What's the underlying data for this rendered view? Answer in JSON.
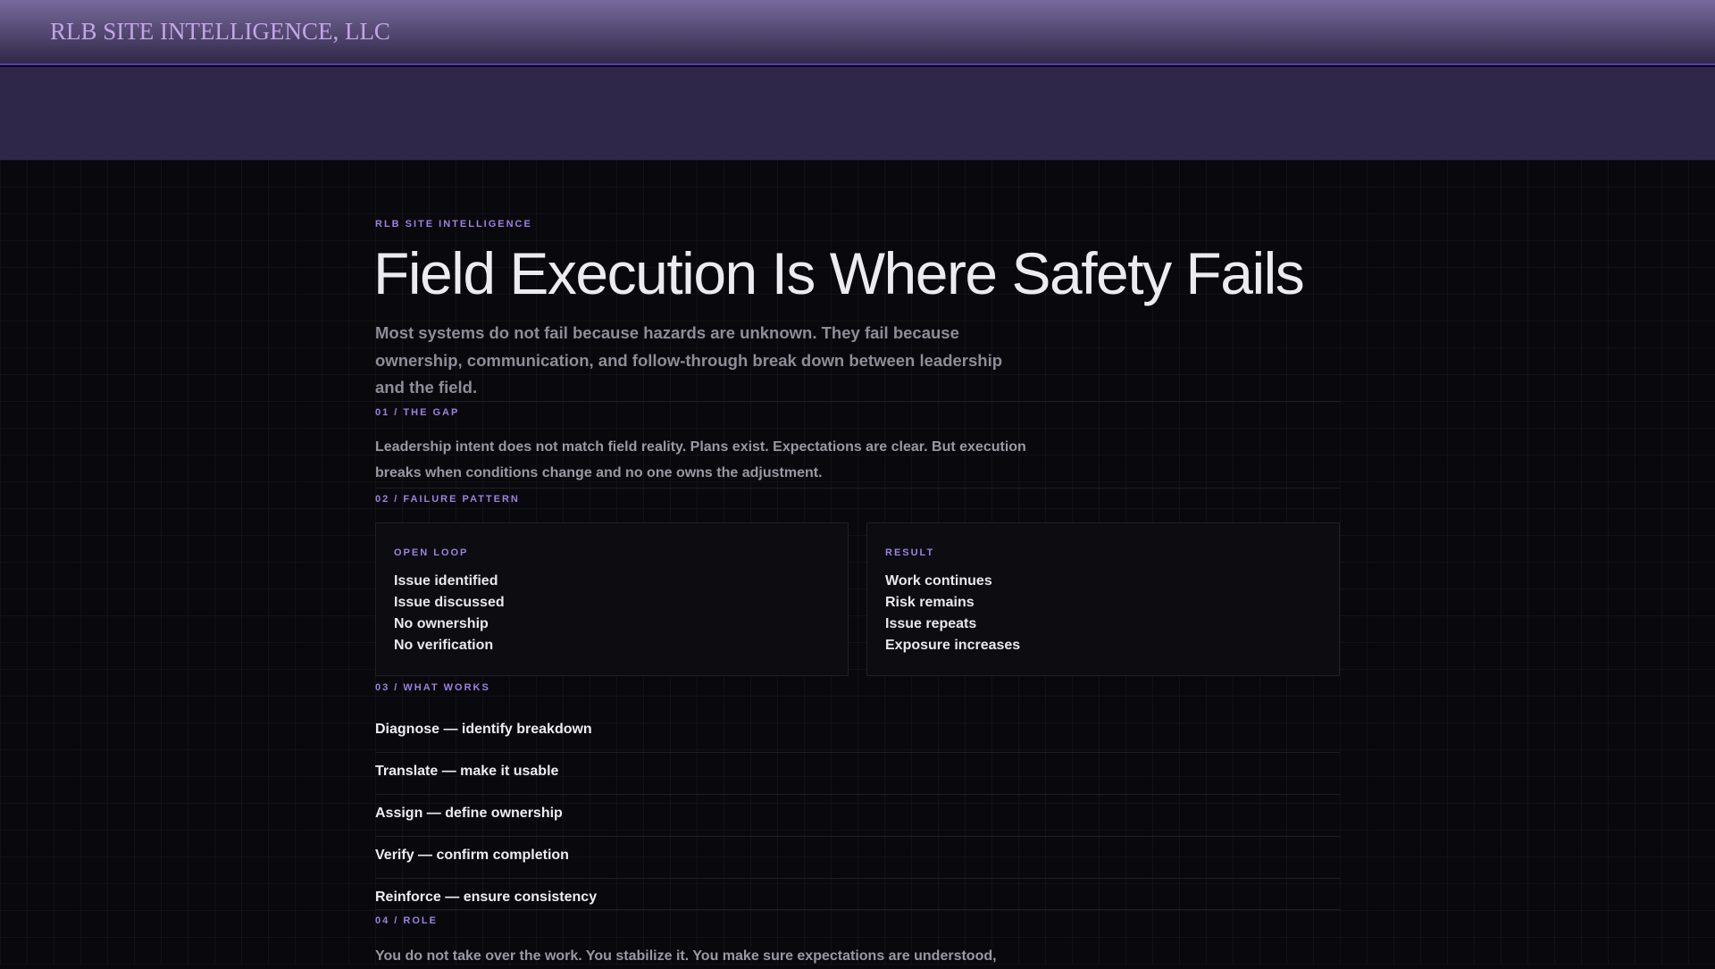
{
  "header": {
    "brand": "RLB SITE INTELLIGENCE, LLC"
  },
  "hero": {
    "eyebrow": "RLB SITE INTELLIGENCE",
    "title": "Field Execution Is Where Safety Fails",
    "lede": "Most systems do not fail because hazards are unknown. They fail because ownership, communication, and follow-through break down between leadership and the field."
  },
  "sections": [
    {
      "label": "01 / THE GAP",
      "text": "Leadership intent does not match field reality. Plans exist. Expectations are clear. But execution breaks when conditions change and no one owns the adjustment."
    },
    {
      "label": "02 / FAILURE PATTERN",
      "cards": [
        {
          "label": "OPEN LOOP",
          "items": [
            "Issue identified",
            "Issue discussed",
            "No ownership",
            "No verification"
          ]
        },
        {
          "label": "RESULT",
          "items": [
            "Work continues",
            "Risk remains",
            "Issue repeats",
            "Exposure increases"
          ]
        }
      ]
    },
    {
      "label": "03 / WHAT WORKS",
      "steps": [
        "Diagnose — identify breakdown",
        "Translate — make it usable",
        "Assign — define ownership",
        "Verify — confirm completion",
        "Reinforce — ensure consistency"
      ]
    },
    {
      "label": "04 / ROLE",
      "text": "You do not take over the work. You stabilize it. You make sure expectations are understood,"
    }
  ]
}
